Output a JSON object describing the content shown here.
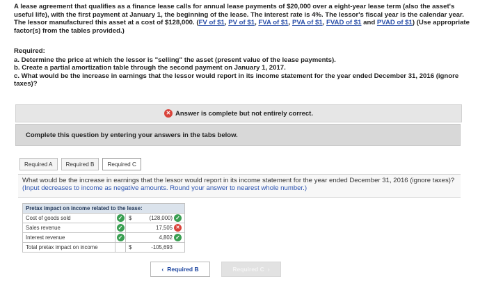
{
  "problem": {
    "intro": "A lease agreement that qualifies as a finance lease calls for annual lease payments of $20,000 over a eight-year lease term (also the asset's useful life), with the first payment at January 1, the beginning of the lease. The interest rate is 4%. The lessor's fiscal year is the calendar year. The lessor manufactured this asset at a cost of $128,000. (",
    "links": [
      "FV of $1",
      "PV of $1",
      "FVA of $1",
      "PVA of $1",
      "FVAD of $1",
      "PVAD of $1"
    ],
    "link_sep": ", ",
    "link_and": " and ",
    "outro": ") (Use appropriate factor(s) from the tables provided.)"
  },
  "required": {
    "heading": "Required:",
    "items": [
      "a. Determine the price at which the lessor is \"selling\" the asset (present value of the lease payments).",
      "b. Create a partial amortization table through the second payment on January 1, 2017.",
      "c. What would be the increase in earnings that the lessor would report in its income statement for the year ended December 31, 2016 (ignore taxes)?"
    ]
  },
  "status": {
    "icon": "x-circle-icon",
    "text": "Answer is complete but not entirely correct."
  },
  "instruction": "Complete this question by entering your answers in the tabs below.",
  "tabs": [
    {
      "label": "Required A",
      "active": false
    },
    {
      "label": "Required B",
      "active": false
    },
    {
      "label": "Required C",
      "active": true
    }
  ],
  "question": {
    "text": "What would be the increase in earnings that the lessor would report in its income statement for the year ended December 31, 2016 (ignore taxes)? ",
    "hint": "(Input decreases to income as negative amounts. Round your answer to nearest whole number.)"
  },
  "table": {
    "title": "Pretax impact on income related to the lease:",
    "rows": [
      {
        "label": "Cost of goods sold",
        "dollar": "$",
        "value": "(128,000)",
        "row_check": "ok",
        "value_check": "ok"
      },
      {
        "label": "Sales revenue",
        "dollar": "",
        "value": "17,505",
        "row_check": "ok",
        "value_check": "bad"
      },
      {
        "label": "Interest revenue",
        "dollar": "",
        "value": "4,802",
        "row_check": "ok",
        "value_check": "ok"
      },
      {
        "label": "Total pretax impact on income",
        "dollar": "$",
        "value": "-105,693",
        "row_check": "",
        "value_check": ""
      }
    ]
  },
  "nav": {
    "prev_label": "Required B",
    "next_label": "Required C"
  },
  "colors": {
    "ok": "#3a9f52",
    "bad": "#d9433a",
    "link": "#2a4fa8",
    "header": "#dbe3ec"
  }
}
